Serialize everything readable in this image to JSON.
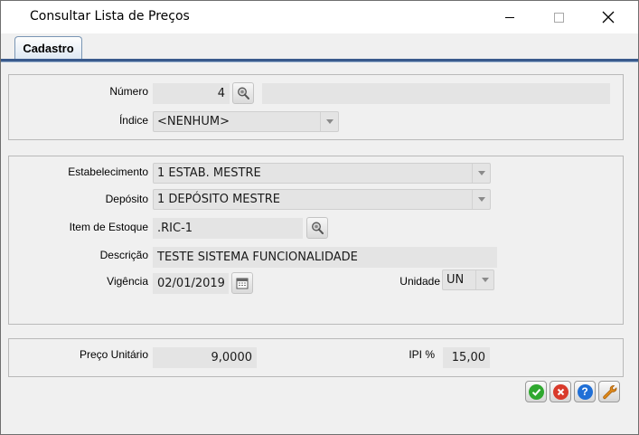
{
  "window": {
    "title": "Consultar Lista de Preços",
    "controls": [
      "minimize",
      "maximize",
      "close"
    ]
  },
  "tabs": [
    {
      "label": "Cadastro",
      "active": true
    }
  ],
  "group1": {
    "numero": {
      "label": "Número",
      "value": "4",
      "description": ""
    },
    "indice": {
      "label": "Índice",
      "value": "<NENHUM>"
    }
  },
  "group2": {
    "estabelecimento": {
      "label": "Estabelecimento",
      "value": "1 ESTAB. MESTRE"
    },
    "deposito": {
      "label": "Depósito",
      "value": "1 DEPÓSITO MESTRE"
    },
    "item_estoque": {
      "label": "Item de Estoque",
      "value": ".RIC-1"
    },
    "descricao": {
      "label": "Descrição",
      "value": "TESTE SISTEMA FUNCIONALIDADE"
    },
    "vigencia": {
      "label": "Vigência",
      "value": "02/01/2019"
    },
    "unidade": {
      "label": "Unidade",
      "value": "UN"
    }
  },
  "group3": {
    "preco_unitario": {
      "label": "Preço Unitário",
      "value": "9,0000"
    },
    "ipi": {
      "label": "IPI %",
      "value": "15,00"
    }
  },
  "actions": [
    {
      "name": "confirm",
      "icon": "check-icon",
      "color": "#2fa82f"
    },
    {
      "name": "cancel",
      "icon": "x-circle-icon",
      "color": "#d93a2b"
    },
    {
      "name": "help",
      "icon": "question-icon",
      "color": "#1f6fd6"
    },
    {
      "name": "tools",
      "icon": "wrench-icon",
      "color": "#e08a1a"
    }
  ]
}
